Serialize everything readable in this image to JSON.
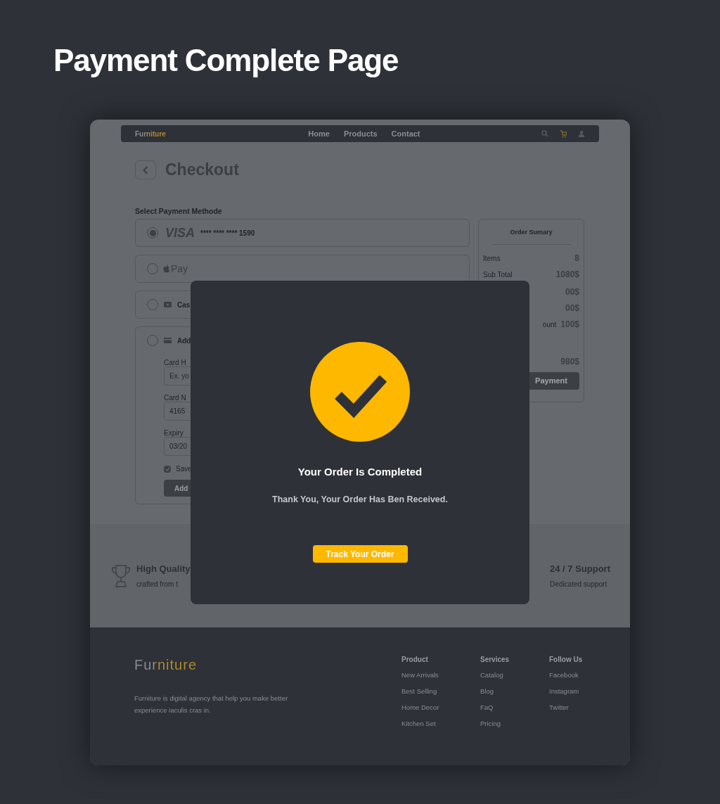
{
  "heading": "Payment Complete Page",
  "nav": {
    "logo": "Furniture",
    "links": [
      "Home",
      "Products",
      "Contact"
    ]
  },
  "checkout": {
    "title": "Checkout",
    "section_label": "Select Payment Methode",
    "methods": [
      {
        "kind": "visa",
        "label": "VISA",
        "number": "**** **** **** 1590",
        "selected": true
      },
      {
        "kind": "applepay",
        "label": "Pay",
        "selected": false
      },
      {
        "kind": "cash",
        "label": "Cas",
        "selected": false
      },
      {
        "kind": "card",
        "label": "Add",
        "selected": false,
        "form": {
          "fields": [
            {
              "label": "Card H",
              "placeholder": "Ex. yo"
            },
            {
              "label": "Card N",
              "value": "4165"
            },
            {
              "label": "Expiry",
              "value": "03/20"
            }
          ],
          "save": {
            "label": "Save",
            "checked": true
          },
          "button": "Add"
        }
      }
    ]
  },
  "summary": {
    "title": "Order Sumary",
    "rows": [
      {
        "label": "Items",
        "value": "8"
      },
      {
        "label": "Sub Total",
        "value": "1080$"
      },
      {
        "value": "00$"
      },
      {
        "value": "00$"
      },
      {
        "label": "ount",
        "value": "100$"
      },
      {
        "value": "980$"
      }
    ],
    "button": "Payment"
  },
  "features": [
    {
      "title": "High Quality",
      "subtitle": "crafted from t"
    },
    {
      "title": "24 / 7 Support",
      "subtitle": "Dedicated support"
    }
  ],
  "modal": {
    "title": "Your Order Is Completed",
    "message": "Thank You, Your Order Has Ben Received.",
    "button": "Track Your Order"
  },
  "footer": {
    "logo": "Furniture",
    "description": "Furniture is digital agency that help you make better experience iaculis cras in.",
    "columns": [
      {
        "title": "Product",
        "links": [
          "New Arrivals",
          "Best Selling",
          "Home Decor",
          "Kitchen Set"
        ]
      },
      {
        "title": "Services",
        "links": [
          "Catalog",
          "Blog",
          "FaQ",
          "Pricing"
        ]
      },
      {
        "title": "Follow Us",
        "links": [
          "Facebook",
          "Instagram",
          "Twitter"
        ]
      }
    ]
  }
}
